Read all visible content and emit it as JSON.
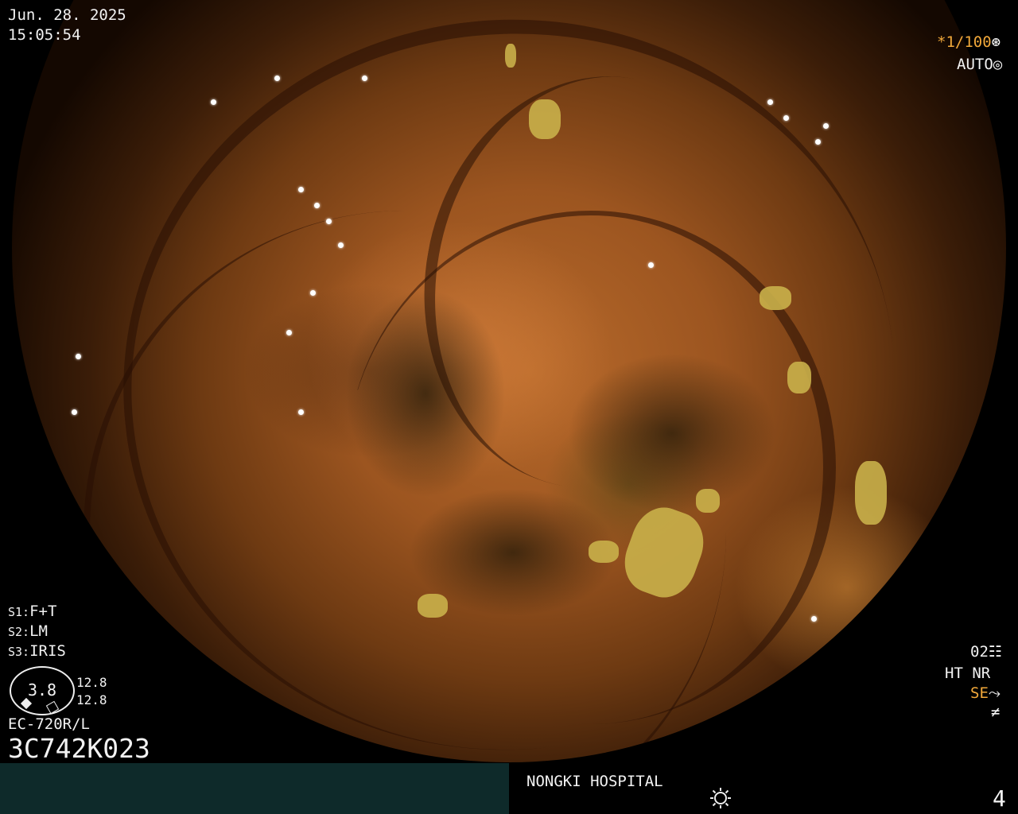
{
  "datetime": {
    "date": "Jun. 28. 2025",
    "time": "15:05:54"
  },
  "top_right": {
    "shutter": "*1/100",
    "shutter_icon": "aperture-icon",
    "mode": "AUTO",
    "mode_icon": "iris-ring-icon",
    "shutter_color": "#f1a83a"
  },
  "settings": {
    "s1_key": "S1:",
    "s1_val": "F+T",
    "s2_key": "S2:",
    "s2_val": "LM",
    "s3_key": "S3:",
    "s3_val": "IRIS"
  },
  "iris_gauge": {
    "value": "3.8",
    "upper": "12.8",
    "lower": "12.8"
  },
  "scope": {
    "model": "EC-720R/L",
    "serial": "3C742K023"
  },
  "bottom_right_status": {
    "level": "02",
    "level_icon": "sliders-icon",
    "ht_nr": "HT NR",
    "se": "SE",
    "se_icon": "curve-icon",
    "freeze_icon": "not-equal-icon"
  },
  "footer": {
    "hospital": "NONGKI HOSPITAL",
    "light_icon": "sun-icon",
    "page": "4"
  }
}
